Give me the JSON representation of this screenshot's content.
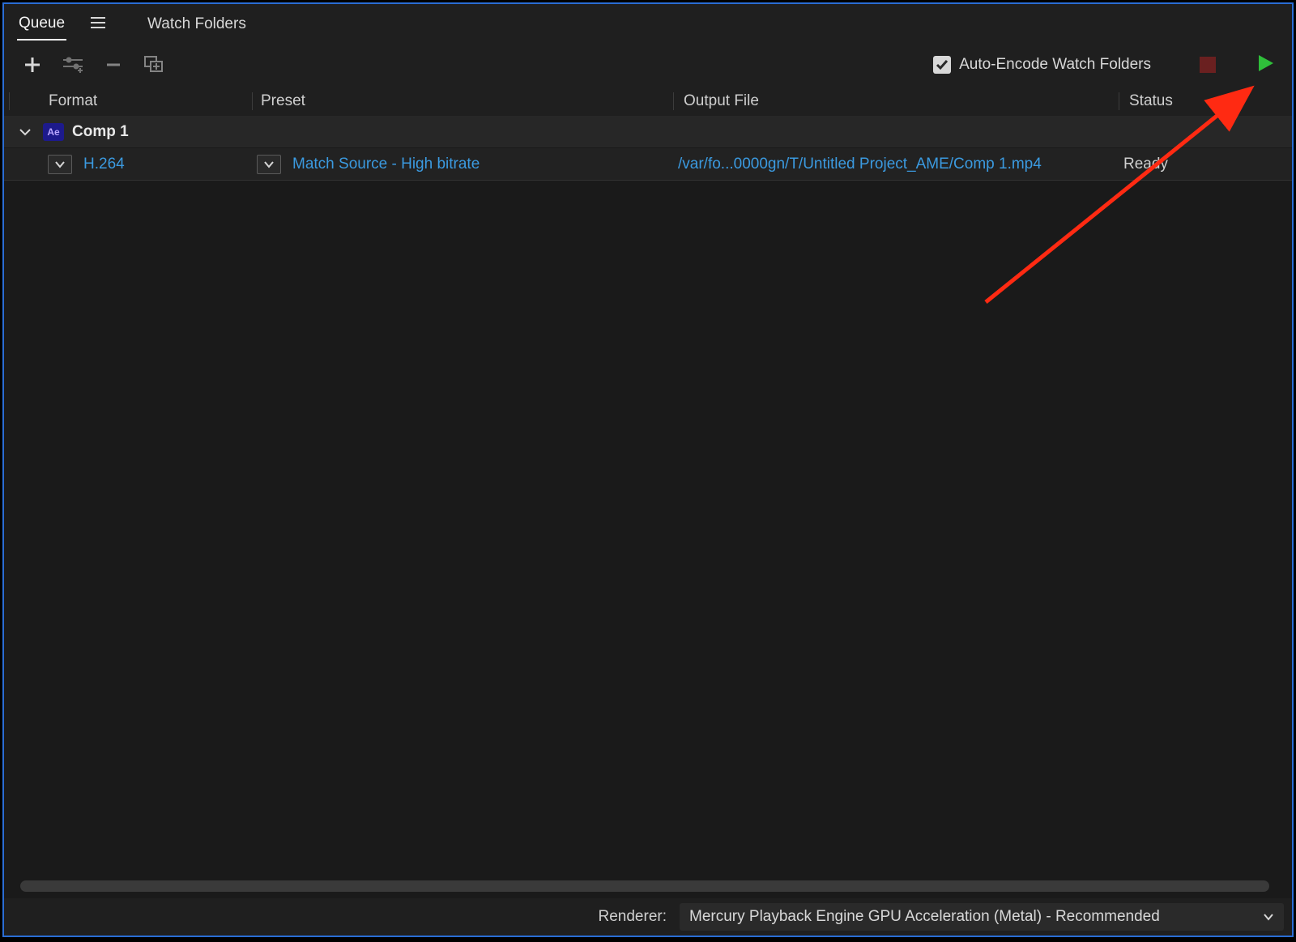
{
  "tabs": {
    "queue": "Queue",
    "watch": "Watch Folders"
  },
  "auto_encode_label": "Auto-Encode Watch Folders",
  "headers": {
    "format": "Format",
    "preset": "Preset",
    "output": "Output File",
    "status": "Status"
  },
  "comp": {
    "badge": "Ae",
    "title": "Comp 1"
  },
  "item": {
    "format": "H.264",
    "preset": "Match Source - High bitrate",
    "output": "/var/fo...0000gn/T/Untitled Project_AME/Comp 1.mp4",
    "status": "Ready"
  },
  "footer": {
    "renderer_label": "Renderer:",
    "renderer_value": "Mercury Playback Engine GPU Acceleration (Metal) - Recommended"
  },
  "colors": {
    "accent_blue": "#2a6dd4",
    "link": "#3b9ae0",
    "play": "#2fbf3a",
    "stop": "#6a2020"
  }
}
